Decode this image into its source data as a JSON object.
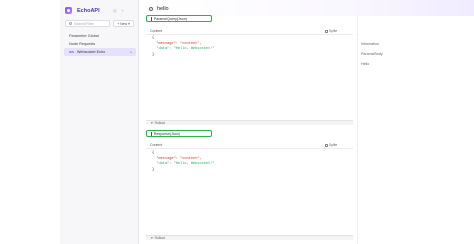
{
  "brand": {
    "name": "EchoAPI"
  },
  "sidebar": {
    "search_placeholder": "Search/Filter",
    "new_button": "New",
    "items": [
      {
        "label": "Parameter Global"
      },
      {
        "label": "Node Requests"
      },
      {
        "badge": "WS",
        "label": "Websocket Echo"
      }
    ]
  },
  "main": {
    "title": "hello",
    "sections": [
      {
        "title": "Params/Query(Json)",
        "split_label": "Splite",
        "content_tab": "Content",
        "code": [
          "{",
          "  \"message\": \"content\",",
          "  \"data\": \"Hello, Websocket!\"",
          "}"
        ],
        "more_label": "Rollout"
      },
      {
        "title": "Response(Json)",
        "split_label": "Splite",
        "content_tab": "Content",
        "code": [
          "{",
          "  \"message\": \"content\",",
          "  \"data\": \"Hello, Websocket!\"",
          "}"
        ],
        "more_label": "Rollout"
      }
    ]
  },
  "right_nav": {
    "items": [
      "Information",
      "Params/Body",
      "Hello"
    ]
  },
  "colors": {
    "accent": "#7c4dff",
    "highlight": "#2bb24c",
    "active_bg": "#e5e1fb"
  }
}
